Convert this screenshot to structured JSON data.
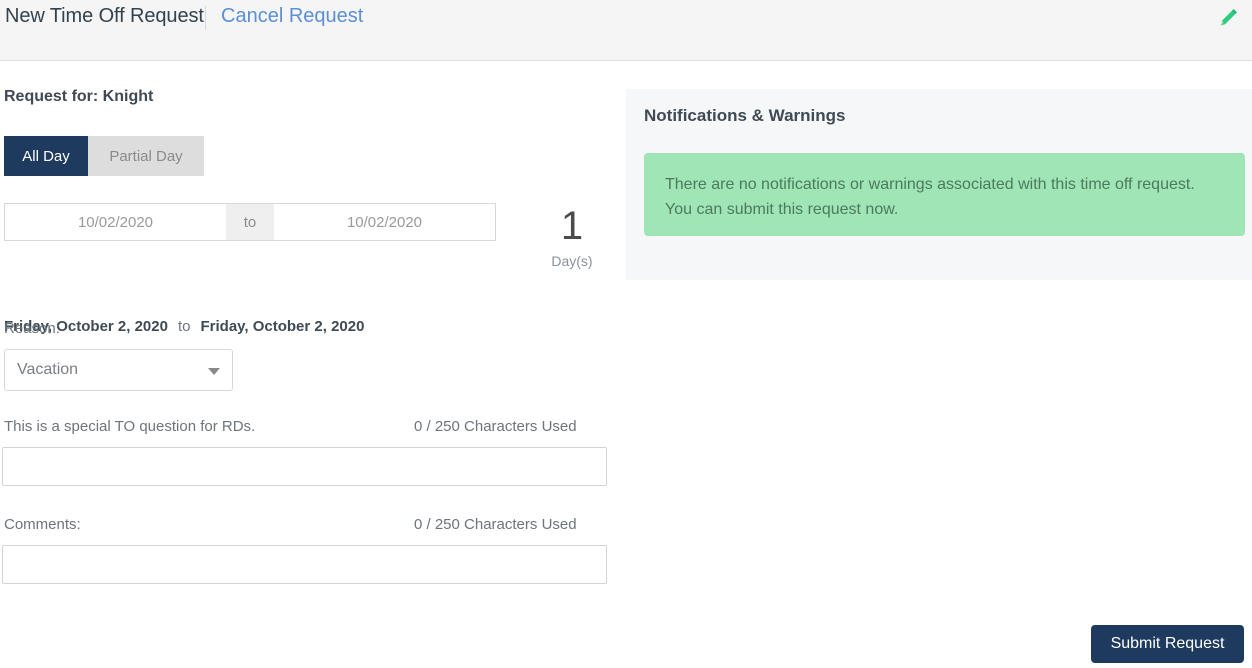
{
  "header": {
    "title": "New Time Off Request",
    "cancel_link": "Cancel Request",
    "edit_icon": "pencil-icon",
    "accent_color": "#5b8fd4",
    "background_color": "#f5f5f5"
  },
  "request": {
    "request_for_label": "Request for: Knight",
    "day_type": {
      "all_day_label": "All Day",
      "partial_day_label": "Partial Day",
      "selected": "All Day",
      "active_color": "#1f3a5f",
      "inactive_color": "#dddddd"
    },
    "dates": {
      "start_value": "10/02/2020",
      "end_value": "10/02/2020",
      "separator_label": "to",
      "start_long": "Friday, October 2, 2020",
      "long_separator": "to",
      "end_long": "Friday, October 2, 2020",
      "days_count": "1",
      "days_label": "Day(s)"
    },
    "reason": {
      "label": "Reason:",
      "value": "Vacation",
      "caret_icon": "chevron-down-icon"
    },
    "special_question": {
      "label": "This is a special TO question for RDs.",
      "counter": "0 / 250 Characters Used",
      "value": "",
      "placeholder": ""
    },
    "comments": {
      "label": "Comments:",
      "counter": "0 / 250 Characters Used",
      "value": "",
      "placeholder": ""
    }
  },
  "notifications": {
    "title": "Notifications & Warnings",
    "alert_text": "There are no notifications or warnings associated with this time off request. You can submit this request now.",
    "alert_background": "#9fe5b6",
    "panel_background": "#f6f7f9"
  },
  "footer": {
    "submit_label": "Submit Request",
    "submit_color": "#1f3a5f"
  }
}
